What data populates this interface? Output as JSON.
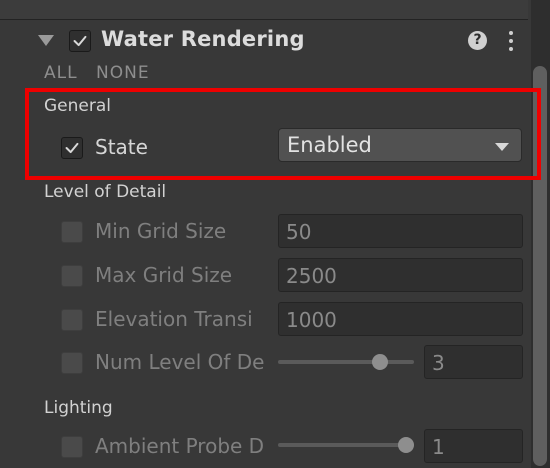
{
  "component": {
    "title": "Water Rendering",
    "enabled": true,
    "help_icon": "?",
    "menu_icon": "vertical-ellipsis-icon"
  },
  "toggle_all": {
    "all_label": "ALL",
    "none_label": "NONE"
  },
  "general": {
    "header": "General",
    "state": {
      "label": "State",
      "checked": true,
      "value": "Enabled"
    }
  },
  "level_of_detail": {
    "header": "Level of Detail",
    "fields": [
      {
        "label": "Min Grid Size",
        "value": "50",
        "checked": false
      },
      {
        "label": "Max Grid Size",
        "value": "2500",
        "checked": false
      },
      {
        "label": "Elevation Transi",
        "value": "1000",
        "checked": false
      },
      {
        "label": "Num Level Of De",
        "value": "3",
        "checked": false,
        "slider_fraction": 0.78
      }
    ]
  },
  "lighting": {
    "header": "Lighting",
    "fields": [
      {
        "label": "Ambient Probe D",
        "value": "1",
        "checked": false,
        "slider_fraction": 1.0
      }
    ]
  },
  "colors": {
    "background": "#383838",
    "highlight": "#ee0000",
    "field": "#2f2f2f",
    "dropdown": "#515151"
  }
}
